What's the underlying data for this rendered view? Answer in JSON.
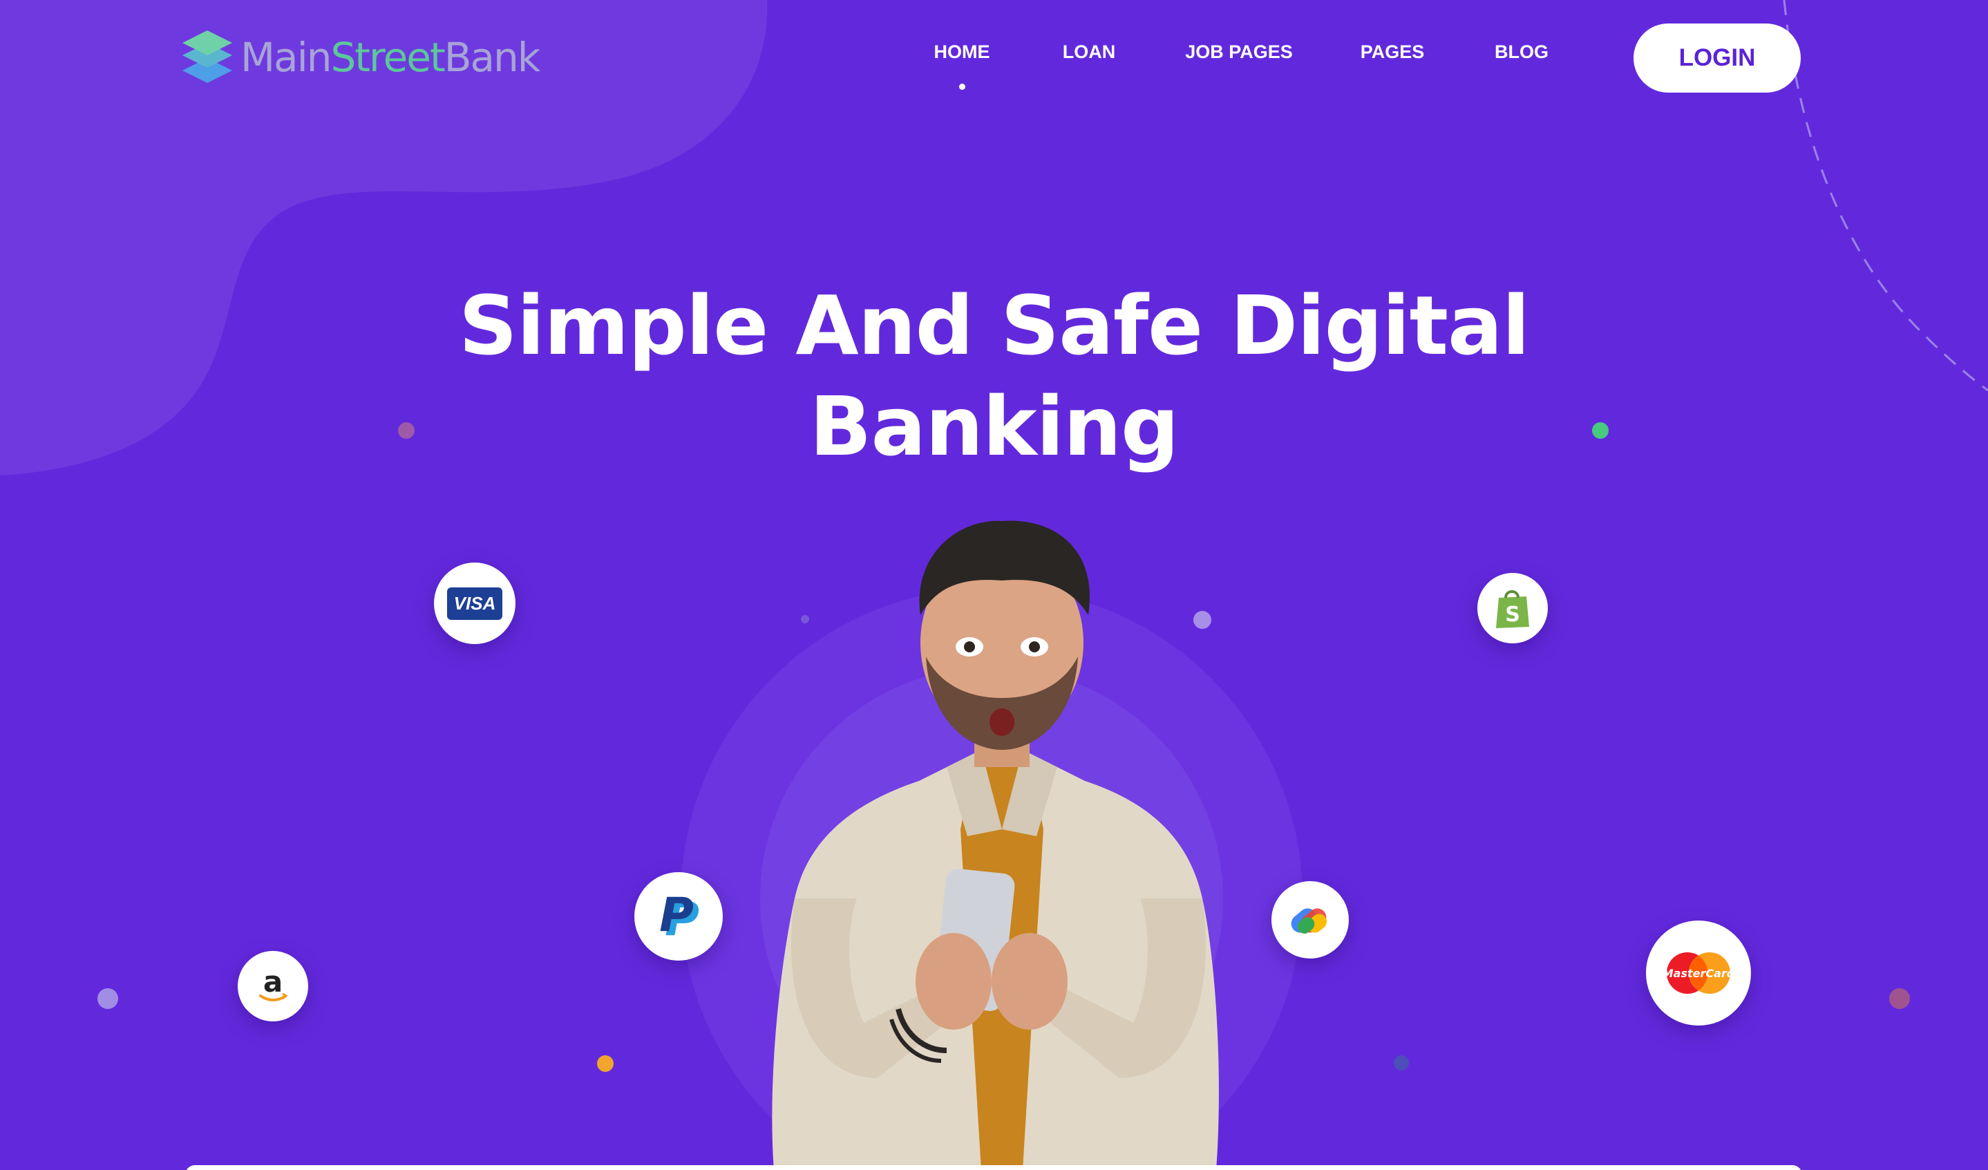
{
  "brand": {
    "name_part1": "Main",
    "name_part2": "Street",
    "name_part3": "Bank",
    "colors": {
      "main": "#a7a4d6",
      "street": "#5cc89a",
      "icon_top": "#6fd1a8",
      "icon_bottom": "#4f9ee8"
    }
  },
  "nav": {
    "items": [
      {
        "label": "HOME",
        "active": true
      },
      {
        "label": "LOAN",
        "active": false
      },
      {
        "label": "JOB PAGES",
        "active": false
      },
      {
        "label": "PAGES",
        "active": false
      },
      {
        "label": "BLOG",
        "active": false
      }
    ],
    "login_label": "LOGIN"
  },
  "hero": {
    "title_line1": "Simple And Safe Digital",
    "title_line2": "Banking"
  },
  "payment_icons": [
    {
      "name": "visa-icon",
      "text": "VISA"
    },
    {
      "name": "shopify-icon",
      "text": "S"
    },
    {
      "name": "paypal-icon",
      "text": "P"
    },
    {
      "name": "google-pay-icon",
      "text": ""
    },
    {
      "name": "amazon-icon",
      "text": "a"
    },
    {
      "name": "mastercard-icon",
      "text": "MasterCard"
    }
  ],
  "colors": {
    "background": "#6229dc",
    "accent_white": "#ffffff",
    "login_text": "#5a23d6"
  }
}
